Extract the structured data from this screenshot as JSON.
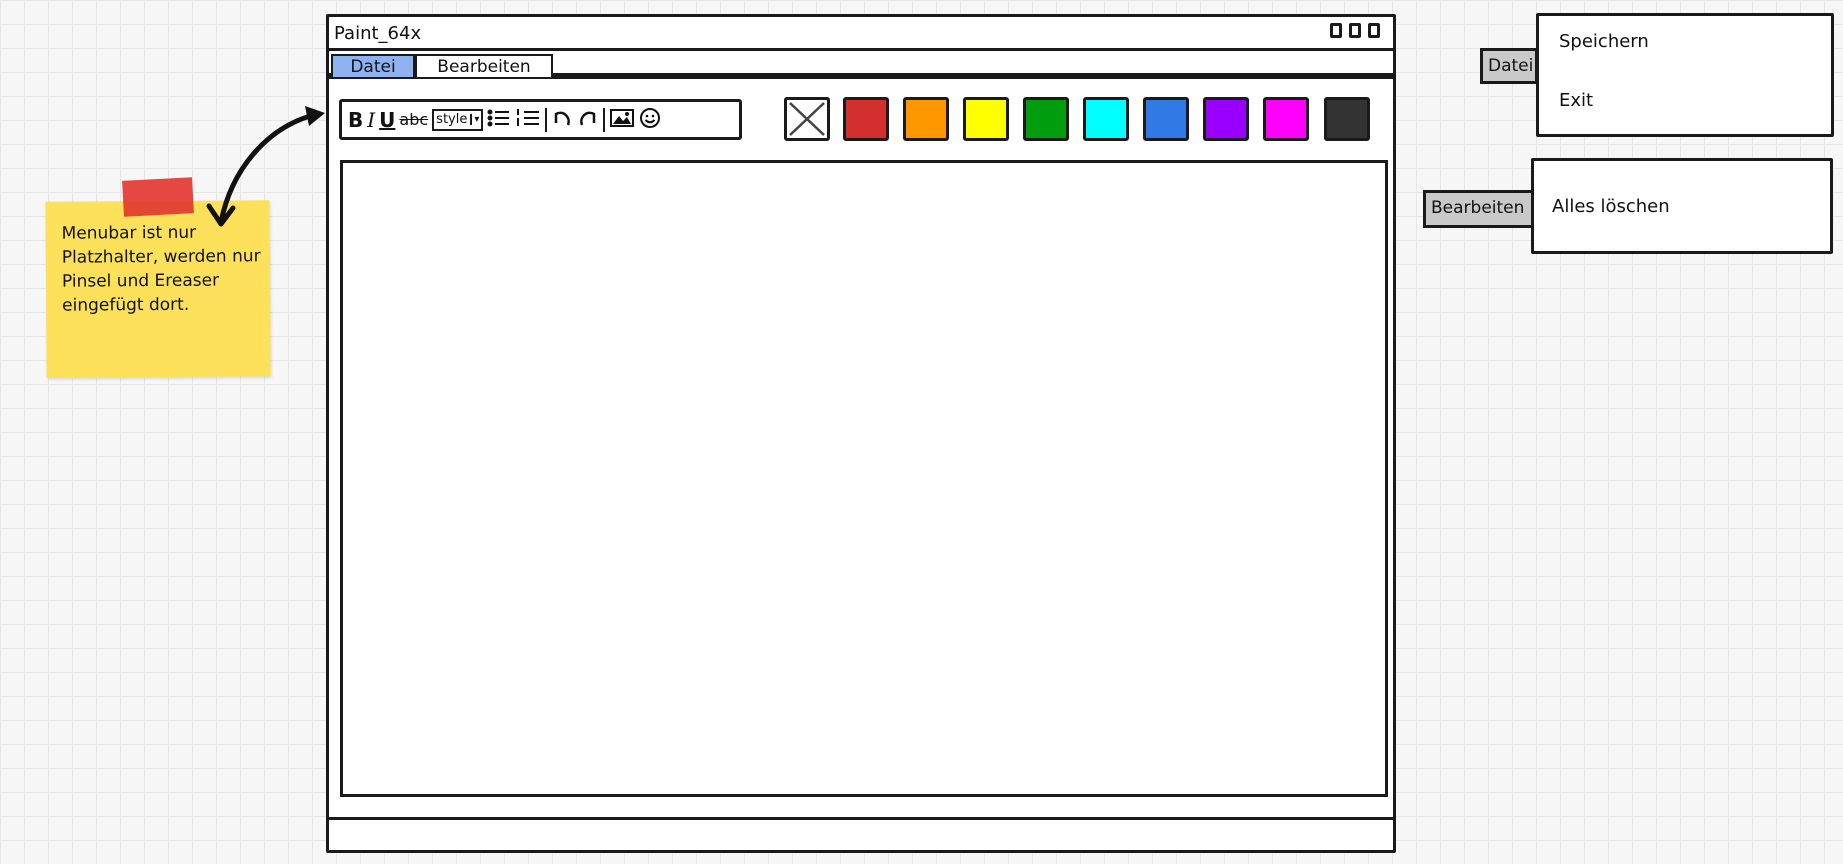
{
  "window": {
    "title": "Paint_64x",
    "controls": [
      "minimize-icon",
      "maximize-icon",
      "close-icon"
    ]
  },
  "menubar": {
    "items": [
      {
        "label": "Datei",
        "active": true
      },
      {
        "label": "Bearbeiten",
        "active": false
      }
    ]
  },
  "toolbar": {
    "bold": "B",
    "italic": "I",
    "underline": "U",
    "strike": "abc",
    "style_label": "style",
    "dropdown_glyph": "▾",
    "icons": [
      "bold-icon",
      "italic-icon",
      "underline-icon",
      "strikethrough-icon",
      "style-dropdown",
      "bulleted-list-icon",
      "numbered-list-icon",
      "undo-icon",
      "redo-icon",
      "image-icon",
      "emoji-icon"
    ]
  },
  "palette": {
    "colors": [
      "none",
      "#d32f2f",
      "#ff9800",
      "#ffff00",
      "#009e0f",
      "#00ffff",
      "#2f7ae5",
      "#9900ff",
      "#ff00ff",
      "#333333"
    ]
  },
  "sticky_note": {
    "text": "Menubar ist nur Platzhalter, werden nur Pinsel und Ereaser eingefügt dort.",
    "color": "#fde15a",
    "tape_color": "#e23a32"
  },
  "dropdowns": {
    "datei": {
      "tab_label": "Datei",
      "items": [
        "Speichern",
        "Exit"
      ]
    },
    "bearbeiten": {
      "tab_label": "Bearbeiten",
      "items": [
        "Alles löschen"
      ]
    }
  },
  "colors": {
    "active_menu": "#8fb3f0",
    "tab_background": "#c9c9c9",
    "outline": "#1a1a1a"
  }
}
